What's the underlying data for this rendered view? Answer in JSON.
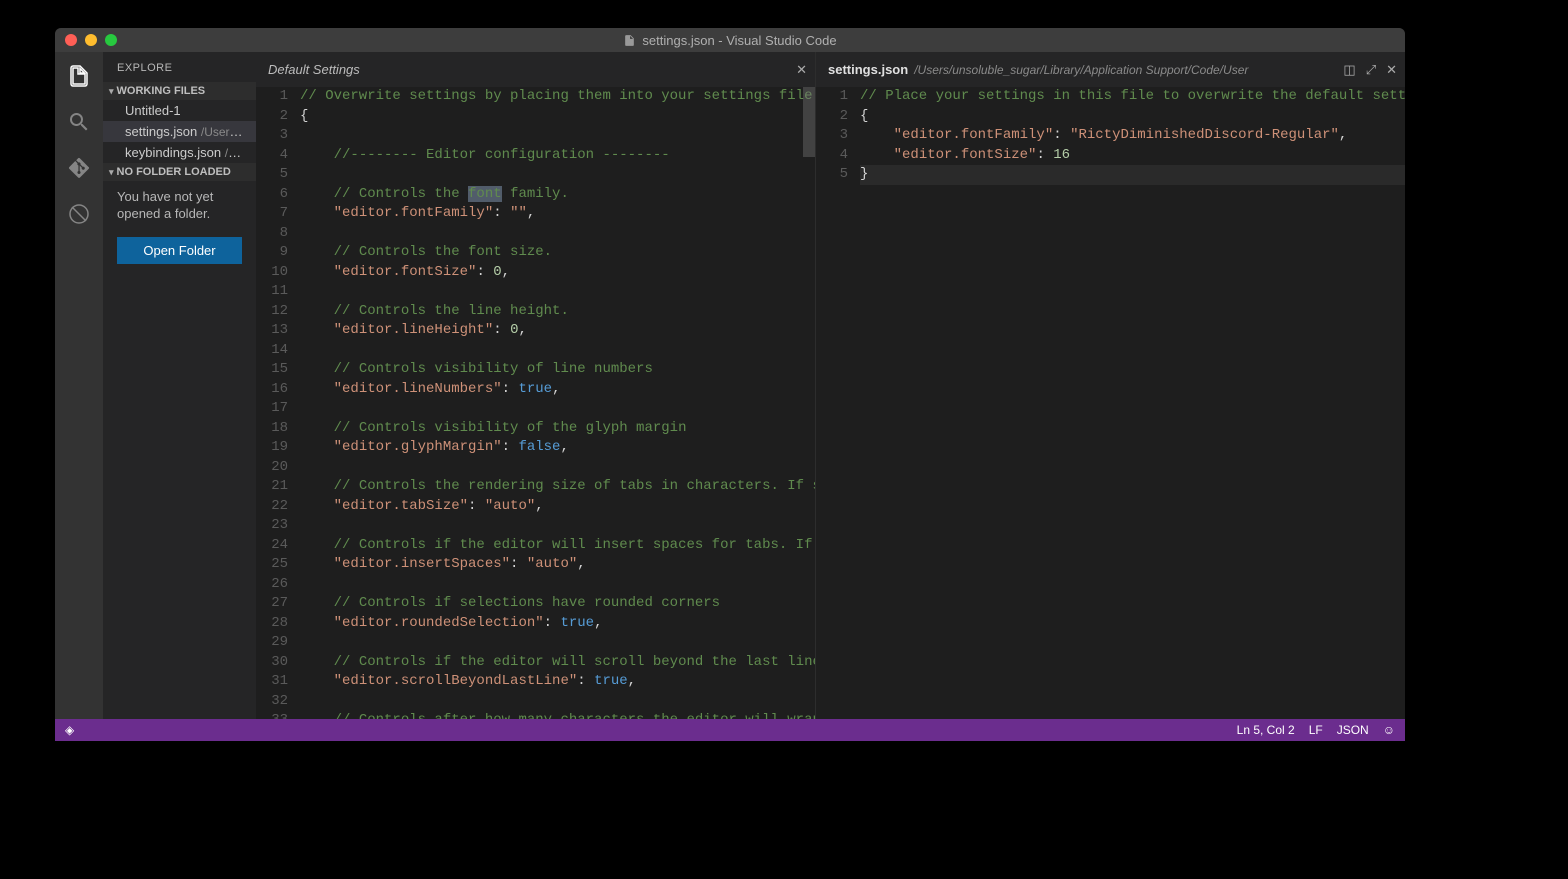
{
  "window": {
    "title": "settings.json - Visual Studio Code"
  },
  "sidebar": {
    "title": "EXPLORE",
    "working_header": "WORKING FILES",
    "working_files": [
      {
        "name": "Untitled-1",
        "path": ""
      },
      {
        "name": "settings.json",
        "path": "/Users/u..."
      },
      {
        "name": "keybindings.json",
        "path": "/Use..."
      }
    ],
    "nofolder_header": "NO FOLDER LOADED",
    "nofolder_msg": "You have not yet opened a folder.",
    "open_folder_label": "Open Folder"
  },
  "editor_left": {
    "tab_title": "Default Settings",
    "lines": [
      {
        "n": 1,
        "type": "comment",
        "indent": 0,
        "text": "// Overwrite settings by placing them into your settings file."
      },
      {
        "n": 2,
        "type": "punct",
        "indent": 0,
        "text": "{"
      },
      {
        "n": 3,
        "type": "blank",
        "indent": 0,
        "text": ""
      },
      {
        "n": 4,
        "type": "comment",
        "indent": 1,
        "text": "//-------- Editor configuration --------"
      },
      {
        "n": 5,
        "type": "blank",
        "indent": 0,
        "text": ""
      },
      {
        "n": 6,
        "type": "comment",
        "indent": 1,
        "text": "// Controls the font family.",
        "hl_word": "font"
      },
      {
        "n": 7,
        "type": "kv",
        "indent": 1,
        "key": "\"editor.fontFamily\"",
        "val": "\"\"",
        "vtype": "str"
      },
      {
        "n": 8,
        "type": "blank",
        "indent": 0,
        "text": ""
      },
      {
        "n": 9,
        "type": "comment",
        "indent": 1,
        "text": "// Controls the font size."
      },
      {
        "n": 10,
        "type": "kv",
        "indent": 1,
        "key": "\"editor.fontSize\"",
        "val": "0",
        "vtype": "num"
      },
      {
        "n": 11,
        "type": "blank",
        "indent": 0,
        "text": ""
      },
      {
        "n": 12,
        "type": "comment",
        "indent": 1,
        "text": "// Controls the line height."
      },
      {
        "n": 13,
        "type": "kv",
        "indent": 1,
        "key": "\"editor.lineHeight\"",
        "val": "0",
        "vtype": "num"
      },
      {
        "n": 14,
        "type": "blank",
        "indent": 0,
        "text": ""
      },
      {
        "n": 15,
        "type": "comment",
        "indent": 1,
        "text": "// Controls visibility of line numbers"
      },
      {
        "n": 16,
        "type": "kv",
        "indent": 1,
        "key": "\"editor.lineNumbers\"",
        "val": "true",
        "vtype": "bool"
      },
      {
        "n": 17,
        "type": "blank",
        "indent": 0,
        "text": ""
      },
      {
        "n": 18,
        "type": "comment",
        "indent": 1,
        "text": "// Controls visibility of the glyph margin"
      },
      {
        "n": 19,
        "type": "kv",
        "indent": 1,
        "key": "\"editor.glyphMargin\"",
        "val": "false",
        "vtype": "bool"
      },
      {
        "n": 20,
        "type": "blank",
        "indent": 0,
        "text": ""
      },
      {
        "n": 21,
        "type": "comment",
        "indent": 1,
        "text": "// Controls the rendering size of tabs in characters. If set to a"
      },
      {
        "n": 22,
        "type": "kv",
        "indent": 1,
        "key": "\"editor.tabSize\"",
        "val": "\"auto\"",
        "vtype": "str"
      },
      {
        "n": 23,
        "type": "blank",
        "indent": 0,
        "text": ""
      },
      {
        "n": 24,
        "type": "comment",
        "indent": 1,
        "text": "// Controls if the editor will insert spaces for tabs. If set to"
      },
      {
        "n": 25,
        "type": "kv",
        "indent": 1,
        "key": "\"editor.insertSpaces\"",
        "val": "\"auto\"",
        "vtype": "str"
      },
      {
        "n": 26,
        "type": "blank",
        "indent": 0,
        "text": ""
      },
      {
        "n": 27,
        "type": "comment",
        "indent": 1,
        "text": "// Controls if selections have rounded corners"
      },
      {
        "n": 28,
        "type": "kv",
        "indent": 1,
        "key": "\"editor.roundedSelection\"",
        "val": "true",
        "vtype": "bool"
      },
      {
        "n": 29,
        "type": "blank",
        "indent": 0,
        "text": ""
      },
      {
        "n": 30,
        "type": "comment",
        "indent": 1,
        "text": "// Controls if the editor will scroll beyond the last line"
      },
      {
        "n": 31,
        "type": "kv",
        "indent": 1,
        "key": "\"editor.scrollBeyondLastLine\"",
        "val": "true",
        "vtype": "bool"
      },
      {
        "n": 32,
        "type": "blank",
        "indent": 0,
        "text": ""
      },
      {
        "n": 33,
        "type": "comment",
        "indent": 1,
        "text": "// Controls after how many characters the editor will wrap to the"
      }
    ]
  },
  "editor_right": {
    "tab_title": "settings.json",
    "tab_path": "/Users/unsoluble_sugar/Library/Application Support/Code/User",
    "lines": [
      {
        "n": 1,
        "type": "comment",
        "indent": 0,
        "text": "// Place your settings in this file to overwrite the default settings"
      },
      {
        "n": 2,
        "type": "punct",
        "indent": 0,
        "text": "{"
      },
      {
        "n": 3,
        "type": "kv",
        "indent": 1,
        "key": "\"editor.fontFamily\"",
        "val": "\"RictyDiminishedDiscord-Regular\"",
        "vtype": "str"
      },
      {
        "n": 4,
        "type": "kv",
        "indent": 1,
        "key": "\"editor.fontSize\"",
        "val": "16",
        "vtype": "num",
        "no_comma": true
      },
      {
        "n": 5,
        "type": "punct",
        "indent": 0,
        "text": "}",
        "current": true
      }
    ]
  },
  "statusbar": {
    "pos": "Ln 5, Col 2",
    "eol": "LF",
    "lang": "JSON",
    "smile": "☺"
  }
}
